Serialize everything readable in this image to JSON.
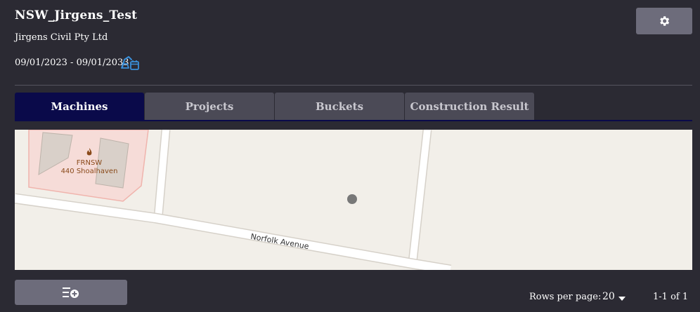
{
  "header": {
    "title": "NSW_Jirgens_Test",
    "company": "Jirgens Civil Pty Ltd",
    "date_range": "09/01/2023 - 09/01/2033",
    "settings_icon": "gear-icon",
    "calendar_icon": "excavator-calendar-icon"
  },
  "tabs": [
    {
      "label": "Machines",
      "active": true
    },
    {
      "label": "Projects",
      "active": false
    },
    {
      "label": "Buckets",
      "active": false
    },
    {
      "label": "Construction Result",
      "active": false
    }
  ],
  "map": {
    "poi_name": "FRNSW",
    "poi_address": "440 Shoalhaven",
    "street_label": "Norfolk Avenue"
  },
  "footer": {
    "add_icon": "add-list-icon",
    "rows_per_page_label": "Rows per page:",
    "rows_per_page_value": "20",
    "page_range": "1-1 of 1"
  },
  "colors": {
    "background": "#2b2a33",
    "button": "#6d6c7b",
    "active_tab": "#0a0a4a",
    "inactive_tab": "#4b4a56",
    "accent_icon": "#3a8fd9"
  }
}
